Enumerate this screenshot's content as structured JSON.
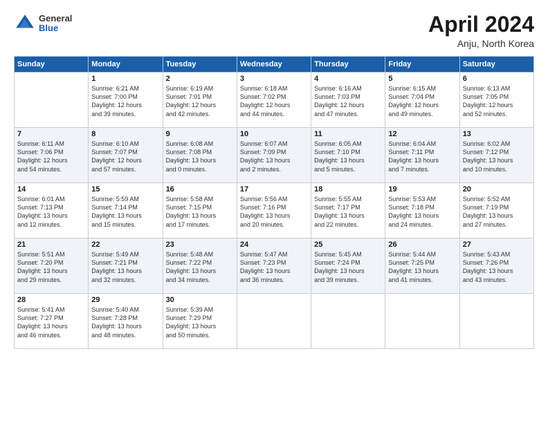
{
  "header": {
    "logo_general": "General",
    "logo_blue": "Blue",
    "title": "April 2024",
    "subtitle": "Anju, North Korea"
  },
  "days": [
    "Sunday",
    "Monday",
    "Tuesday",
    "Wednesday",
    "Thursday",
    "Friday",
    "Saturday"
  ],
  "weeks": [
    [
      {
        "date": "",
        "info": ""
      },
      {
        "date": "1",
        "info": "Sunrise: 6:21 AM\nSunset: 7:00 PM\nDaylight: 12 hours\nand 39 minutes."
      },
      {
        "date": "2",
        "info": "Sunrise: 6:19 AM\nSunset: 7:01 PM\nDaylight: 12 hours\nand 42 minutes."
      },
      {
        "date": "3",
        "info": "Sunrise: 6:18 AM\nSunset: 7:02 PM\nDaylight: 12 hours\nand 44 minutes."
      },
      {
        "date": "4",
        "info": "Sunrise: 6:16 AM\nSunset: 7:03 PM\nDaylight: 12 hours\nand 47 minutes."
      },
      {
        "date": "5",
        "info": "Sunrise: 6:15 AM\nSunset: 7:04 PM\nDaylight: 12 hours\nand 49 minutes."
      },
      {
        "date": "6",
        "info": "Sunrise: 6:13 AM\nSunset: 7:05 PM\nDaylight: 12 hours\nand 52 minutes."
      }
    ],
    [
      {
        "date": "7",
        "info": "Sunrise: 6:11 AM\nSunset: 7:06 PM\nDaylight: 12 hours\nand 54 minutes."
      },
      {
        "date": "8",
        "info": "Sunrise: 6:10 AM\nSunset: 7:07 PM\nDaylight: 12 hours\nand 57 minutes."
      },
      {
        "date": "9",
        "info": "Sunrise: 6:08 AM\nSunset: 7:08 PM\nDaylight: 13 hours\nand 0 minutes."
      },
      {
        "date": "10",
        "info": "Sunrise: 6:07 AM\nSunset: 7:09 PM\nDaylight: 13 hours\nand 2 minutes."
      },
      {
        "date": "11",
        "info": "Sunrise: 6:05 AM\nSunset: 7:10 PM\nDaylight: 13 hours\nand 5 minutes."
      },
      {
        "date": "12",
        "info": "Sunrise: 6:04 AM\nSunset: 7:11 PM\nDaylight: 13 hours\nand 7 minutes."
      },
      {
        "date": "13",
        "info": "Sunrise: 6:02 AM\nSunset: 7:12 PM\nDaylight: 13 hours\nand 10 minutes."
      }
    ],
    [
      {
        "date": "14",
        "info": "Sunrise: 6:01 AM\nSunset: 7:13 PM\nDaylight: 13 hours\nand 12 minutes."
      },
      {
        "date": "15",
        "info": "Sunrise: 5:59 AM\nSunset: 7:14 PM\nDaylight: 13 hours\nand 15 minutes."
      },
      {
        "date": "16",
        "info": "Sunrise: 5:58 AM\nSunset: 7:15 PM\nDaylight: 13 hours\nand 17 minutes."
      },
      {
        "date": "17",
        "info": "Sunrise: 5:56 AM\nSunset: 7:16 PM\nDaylight: 13 hours\nand 20 minutes."
      },
      {
        "date": "18",
        "info": "Sunrise: 5:55 AM\nSunset: 7:17 PM\nDaylight: 13 hours\nand 22 minutes."
      },
      {
        "date": "19",
        "info": "Sunrise: 5:53 AM\nSunset: 7:18 PM\nDaylight: 13 hours\nand 24 minutes."
      },
      {
        "date": "20",
        "info": "Sunrise: 5:52 AM\nSunset: 7:19 PM\nDaylight: 13 hours\nand 27 minutes."
      }
    ],
    [
      {
        "date": "21",
        "info": "Sunrise: 5:51 AM\nSunset: 7:20 PM\nDaylight: 13 hours\nand 29 minutes."
      },
      {
        "date": "22",
        "info": "Sunrise: 5:49 AM\nSunset: 7:21 PM\nDaylight: 13 hours\nand 32 minutes."
      },
      {
        "date": "23",
        "info": "Sunrise: 5:48 AM\nSunset: 7:22 PM\nDaylight: 13 hours\nand 34 minutes."
      },
      {
        "date": "24",
        "info": "Sunrise: 5:47 AM\nSunset: 7:23 PM\nDaylight: 13 hours\nand 36 minutes."
      },
      {
        "date": "25",
        "info": "Sunrise: 5:45 AM\nSunset: 7:24 PM\nDaylight: 13 hours\nand 39 minutes."
      },
      {
        "date": "26",
        "info": "Sunrise: 5:44 AM\nSunset: 7:25 PM\nDaylight: 13 hours\nand 41 minutes."
      },
      {
        "date": "27",
        "info": "Sunrise: 5:43 AM\nSunset: 7:26 PM\nDaylight: 13 hours\nand 43 minutes."
      }
    ],
    [
      {
        "date": "28",
        "info": "Sunrise: 5:41 AM\nSunset: 7:27 PM\nDaylight: 13 hours\nand 46 minutes."
      },
      {
        "date": "29",
        "info": "Sunrise: 5:40 AM\nSunset: 7:28 PM\nDaylight: 13 hours\nand 48 minutes."
      },
      {
        "date": "30",
        "info": "Sunrise: 5:39 AM\nSunset: 7:29 PM\nDaylight: 13 hours\nand 50 minutes."
      },
      {
        "date": "",
        "info": ""
      },
      {
        "date": "",
        "info": ""
      },
      {
        "date": "",
        "info": ""
      },
      {
        "date": "",
        "info": ""
      }
    ]
  ]
}
